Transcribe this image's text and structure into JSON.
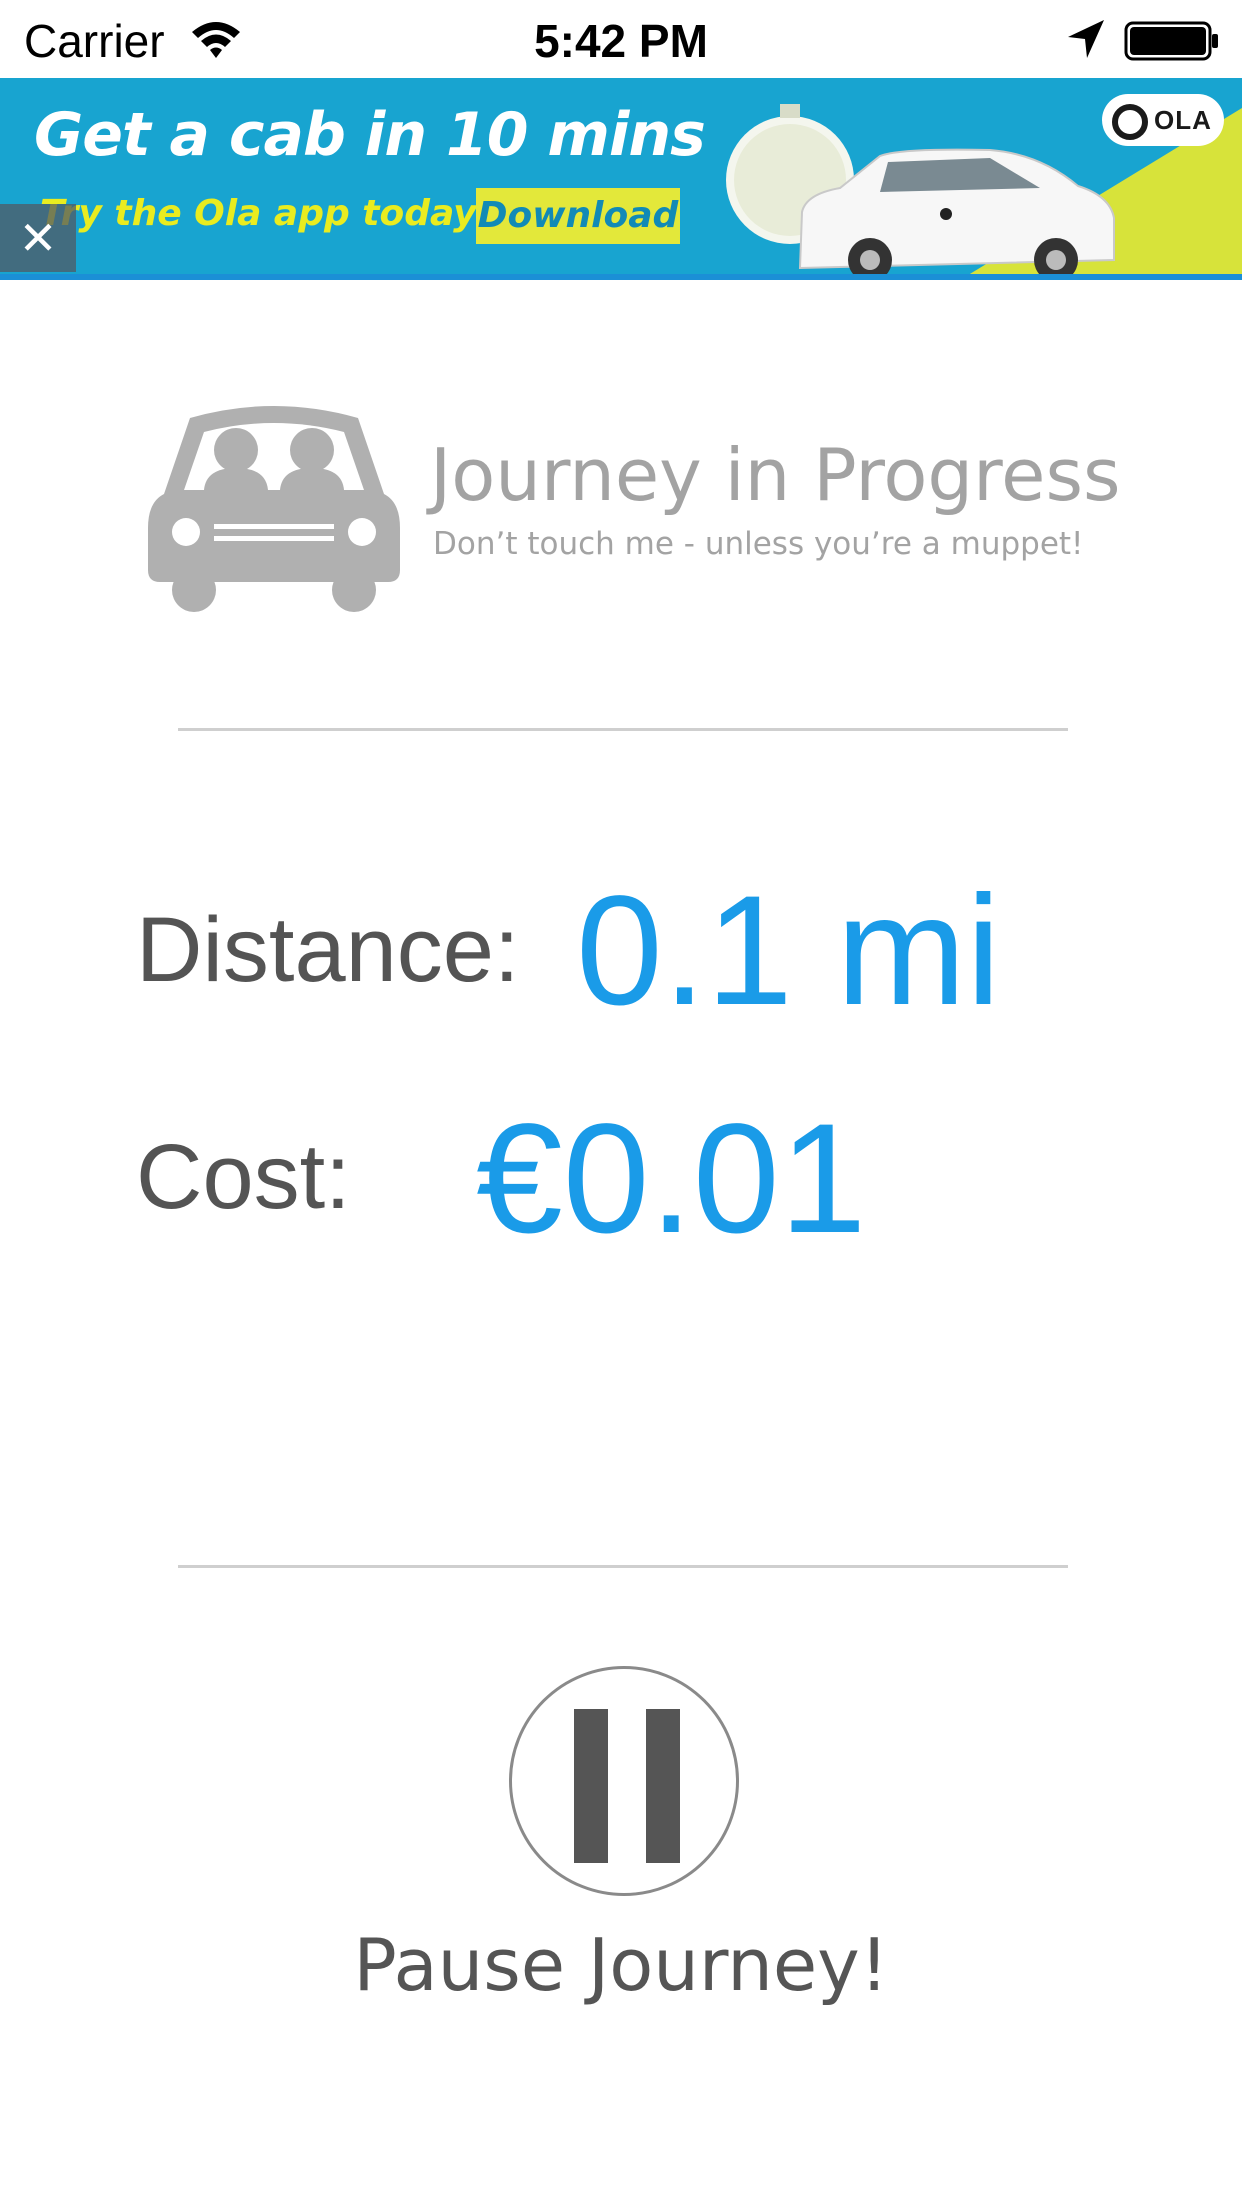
{
  "status_bar": {
    "carrier": "Carrier",
    "time": "5:42 PM",
    "icons": [
      "wifi-icon",
      "location-arrow-icon",
      "battery-icon"
    ]
  },
  "ad_banner": {
    "headline": "Get a cab in 10 mins",
    "subline": "Try the Ola app today",
    "download_label": "Download",
    "brand_logo": "OLA",
    "close_symbol": "✕",
    "colors": {
      "background": "#18a4d0",
      "accent": "#e3e83a"
    }
  },
  "journey": {
    "icon": "car-icon",
    "title": "Journey in Progress",
    "subtitle": "Don’t touch me - unless you’re a muppet!"
  },
  "stats": {
    "distance_label": "Distance:",
    "distance_value": "0.1 mi",
    "cost_label": "Cost:",
    "cost_value": "€0.01"
  },
  "pause": {
    "icon": "pause-icon",
    "label": "Pause Journey!"
  },
  "colors": {
    "value_blue": "#1a9be8",
    "label_gray": "#545454",
    "header_gray": "#a3a3a3"
  }
}
